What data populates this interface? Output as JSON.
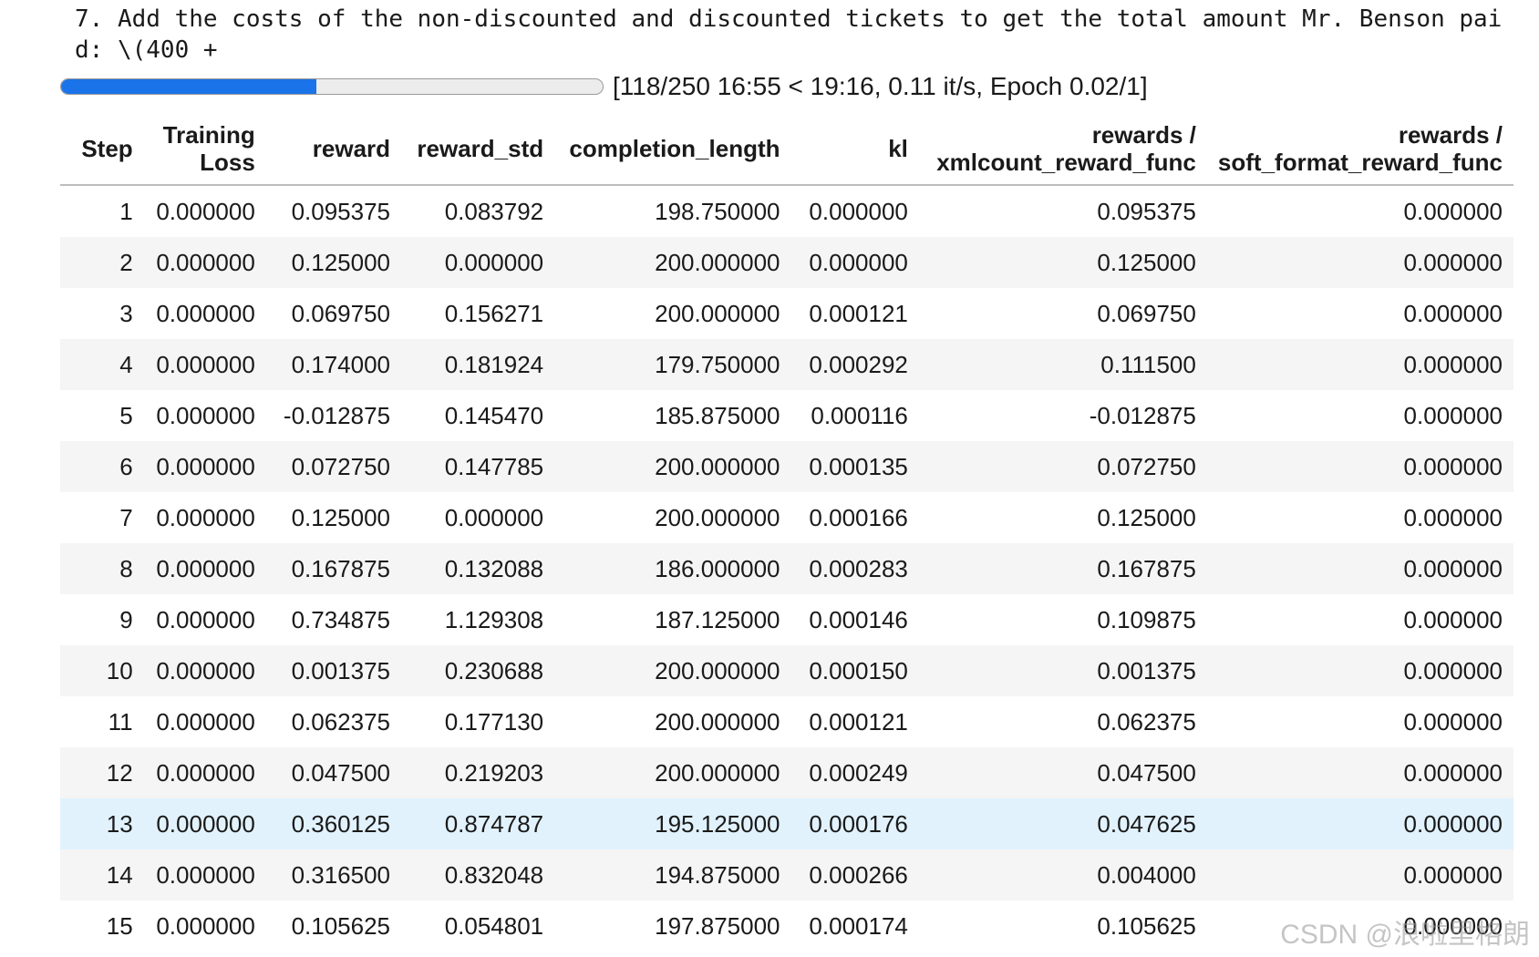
{
  "output_text": {
    "line1": "7. Add the costs of the non-discounted and discounted tickets to get the total amount Mr. Benson pai",
    "line2": "d: \\(400 +"
  },
  "progress": {
    "fraction": 0.472,
    "status_text": "[118/250 16:55 < 19:16, 0.11 it/s, Epoch 0.02/1]",
    "fill_color": "#1a73e8"
  },
  "table": {
    "headers": {
      "step": "Step",
      "training_loss_1": "Training",
      "training_loss_2": "Loss",
      "reward": "reward",
      "reward_std": "reward_std",
      "completion_length": "completion_length",
      "kl": "kl",
      "xml_1": "rewards /",
      "xml_2": "xmlcount_reward_func",
      "soft_1": "rewards /",
      "soft_2": "soft_format_reward_func"
    },
    "rows": [
      {
        "step": "1",
        "loss": "0.000000",
        "reward": "0.095375",
        "reward_std": "0.083792",
        "completion_length": "198.750000",
        "kl": "0.000000",
        "xml": "0.095375",
        "soft": "0.000000"
      },
      {
        "step": "2",
        "loss": "0.000000",
        "reward": "0.125000",
        "reward_std": "0.000000",
        "completion_length": "200.000000",
        "kl": "0.000000",
        "xml": "0.125000",
        "soft": "0.000000"
      },
      {
        "step": "3",
        "loss": "0.000000",
        "reward": "0.069750",
        "reward_std": "0.156271",
        "completion_length": "200.000000",
        "kl": "0.000121",
        "xml": "0.069750",
        "soft": "0.000000"
      },
      {
        "step": "4",
        "loss": "0.000000",
        "reward": "0.174000",
        "reward_std": "0.181924",
        "completion_length": "179.750000",
        "kl": "0.000292",
        "xml": "0.111500",
        "soft": "0.000000"
      },
      {
        "step": "5",
        "loss": "0.000000",
        "reward": "-0.012875",
        "reward_std": "0.145470",
        "completion_length": "185.875000",
        "kl": "0.000116",
        "xml": "-0.012875",
        "soft": "0.000000"
      },
      {
        "step": "6",
        "loss": "0.000000",
        "reward": "0.072750",
        "reward_std": "0.147785",
        "completion_length": "200.000000",
        "kl": "0.000135",
        "xml": "0.072750",
        "soft": "0.000000"
      },
      {
        "step": "7",
        "loss": "0.000000",
        "reward": "0.125000",
        "reward_std": "0.000000",
        "completion_length": "200.000000",
        "kl": "0.000166",
        "xml": "0.125000",
        "soft": "0.000000"
      },
      {
        "step": "8",
        "loss": "0.000000",
        "reward": "0.167875",
        "reward_std": "0.132088",
        "completion_length": "186.000000",
        "kl": "0.000283",
        "xml": "0.167875",
        "soft": "0.000000"
      },
      {
        "step": "9",
        "loss": "0.000000",
        "reward": "0.734875",
        "reward_std": "1.129308",
        "completion_length": "187.125000",
        "kl": "0.000146",
        "xml": "0.109875",
        "soft": "0.000000"
      },
      {
        "step": "10",
        "loss": "0.000000",
        "reward": "0.001375",
        "reward_std": "0.230688",
        "completion_length": "200.000000",
        "kl": "0.000150",
        "xml": "0.001375",
        "soft": "0.000000"
      },
      {
        "step": "11",
        "loss": "0.000000",
        "reward": "0.062375",
        "reward_std": "0.177130",
        "completion_length": "200.000000",
        "kl": "0.000121",
        "xml": "0.062375",
        "soft": "0.000000"
      },
      {
        "step": "12",
        "loss": "0.000000",
        "reward": "0.047500",
        "reward_std": "0.219203",
        "completion_length": "200.000000",
        "kl": "0.000249",
        "xml": "0.047500",
        "soft": "0.000000"
      },
      {
        "step": "13",
        "loss": "0.000000",
        "reward": "0.360125",
        "reward_std": "0.874787",
        "completion_length": "195.125000",
        "kl": "0.000176",
        "xml": "0.047625",
        "soft": "0.000000"
      },
      {
        "step": "14",
        "loss": "0.000000",
        "reward": "0.316500",
        "reward_std": "0.832048",
        "completion_length": "194.875000",
        "kl": "0.000266",
        "xml": "0.004000",
        "soft": "0.000000"
      },
      {
        "step": "15",
        "loss": "0.000000",
        "reward": "0.105625",
        "reward_std": "0.054801",
        "completion_length": "197.875000",
        "kl": "0.000174",
        "xml": "0.105625",
        "soft": "0.000000"
      }
    ],
    "highlighted_row_index": 12
  },
  "watermark": "CSDN @浪啦里格朗"
}
